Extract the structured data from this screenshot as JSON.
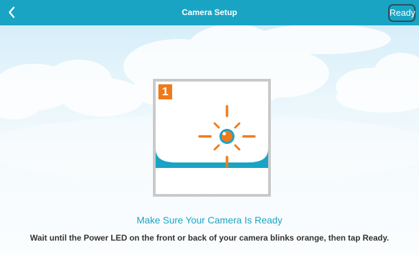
{
  "header": {
    "title": "Camera Setup",
    "ready_label": "Ready",
    "back_icon": "chevron-left-icon"
  },
  "step": {
    "number": "1"
  },
  "content": {
    "heading": "Make Sure Your Camera Is Ready",
    "description": "Wait until the Power LED on the front or back of your camera blinks orange, then tap Ready."
  },
  "colors": {
    "accent": "#1aa4c4",
    "led": "#f07a1a",
    "text": "#333333"
  }
}
